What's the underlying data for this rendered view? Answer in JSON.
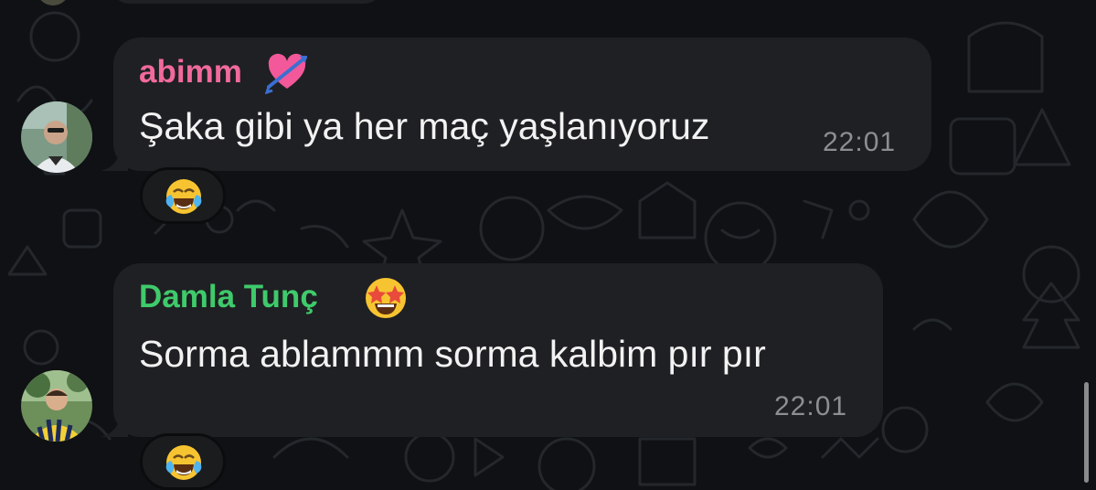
{
  "messages": [
    {
      "sender": "abimm",
      "sender_color": "#f06a9a",
      "sender_emoji": "heart-with-arrow-icon",
      "text": "Şaka gibi ya her maç yaşlanıyoruz",
      "time": "22:01",
      "reaction": "face-with-tears-of-joy-icon"
    },
    {
      "sender": "Damla Tunç",
      "sender_color": "#3fca6b",
      "sender_emoji": "star-struck-icon",
      "text": "Sorma ablammm sorma kalbim pır pır",
      "time": "22:01",
      "reaction": "face-with-tears-of-joy-icon"
    }
  ],
  "colors": {
    "bubble": "#1f2023",
    "background": "#0f1114",
    "text": "#f2f2f2",
    "time": "#8d8e91"
  }
}
